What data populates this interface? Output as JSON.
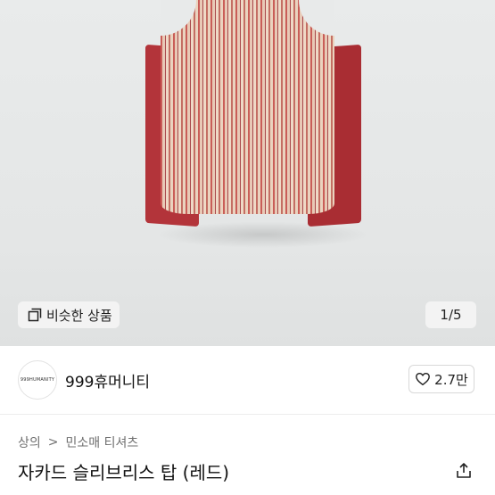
{
  "image_viewer": {
    "similar_products_label": "비슷한 상품",
    "page_counter": "1/5"
  },
  "shop": {
    "avatar_text": "999HUMANITY",
    "name": "999휴머니티",
    "like_count": "2.7만"
  },
  "breadcrumb": {
    "items": [
      "상의",
      "민소매 티셔츠"
    ],
    "separator": ">"
  },
  "product": {
    "title": "자카드 슬리브리스 탑 (레드)"
  },
  "icons": {
    "similar": "copy-icon",
    "like": "heart-icon",
    "share": "share-icon"
  }
}
